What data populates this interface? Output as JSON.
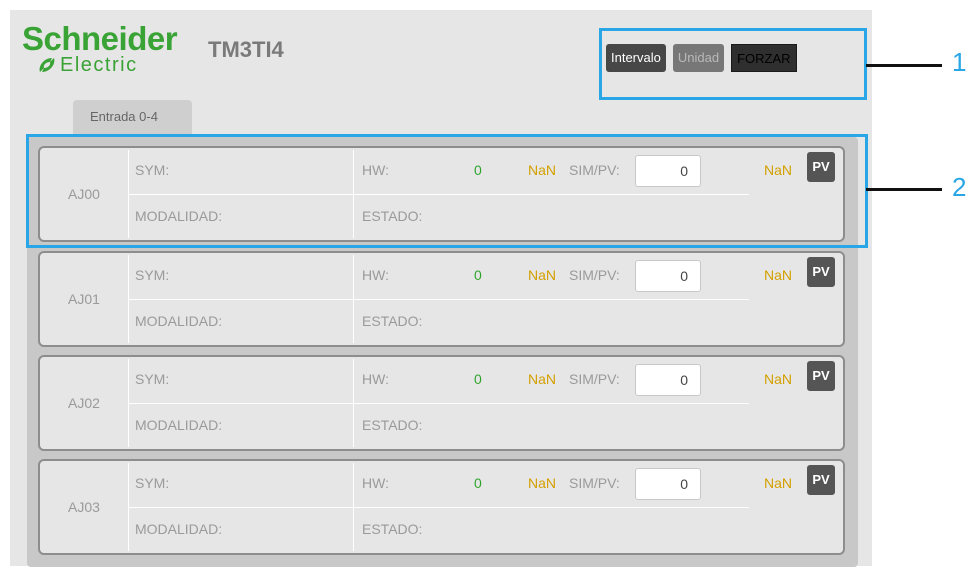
{
  "header": {
    "brand_top": "Schneider",
    "brand_bottom": "Electric",
    "module_title": "TM3TI4"
  },
  "toolbar": {
    "intervalo_label": "Intervalo",
    "unidad_label": "Unidad",
    "forzar_label": "FORZAR"
  },
  "callouts": {
    "one": "1",
    "two": "2",
    "color": "#29a6e6"
  },
  "tab": {
    "label": "Entrada 0-4"
  },
  "labels": {
    "sym": "SYM:",
    "modalidad": "MODALIDAD:",
    "hw": "HW:",
    "estado": "ESTADO:",
    "simpv": "SIM/PV:",
    "pv_button": "PV"
  },
  "channels": [
    {
      "name": "AJ00",
      "hw_value": "0",
      "nan1": "NaN",
      "sim_value": "0",
      "nan2": "NaN"
    },
    {
      "name": "AJ01",
      "hw_value": "0",
      "nan1": "NaN",
      "sim_value": "0",
      "nan2": "NaN"
    },
    {
      "name": "AJ02",
      "hw_value": "0",
      "nan1": "NaN",
      "sim_value": "0",
      "nan2": "NaN"
    },
    {
      "name": "AJ03",
      "hw_value": "0",
      "nan1": "NaN",
      "sim_value": "0",
      "nan2": "NaN"
    }
  ],
  "colors": {
    "brand_green": "#3aa335",
    "hw_value": "#2fa52f",
    "nan": "#d4a000"
  }
}
